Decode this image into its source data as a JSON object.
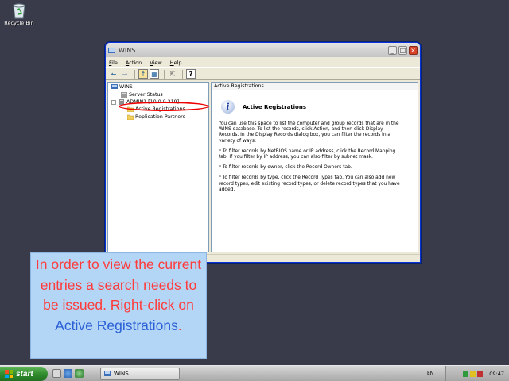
{
  "desktop": {
    "recycle_bin_label": "Recycle Bin"
  },
  "window": {
    "title": "WINS",
    "menu": [
      "File",
      "Action",
      "View",
      "Help"
    ],
    "tree": {
      "root": "WINS",
      "server_status": "Server Status",
      "server": "ADMIN1 [10.0.0.219]",
      "active_registrations": "Active Registrations",
      "replication_partners": "Replication Partners"
    },
    "pane": {
      "header": "Active Registrations",
      "info_title": "Active Registrations",
      "paragraphs": [
        "You can use this space to list the computer and group records that are in the WINS database. To list the records, click Action, and then click Display Records. In the Display Records dialog box, you can filter the records in a variety of ways:",
        "* To filter records by NetBIOS name or IP address, click the Record Mapping tab. If you filter by IP address, you can also filter by subnet mask.",
        "* To filter records by owner, click the Record Owners tab.",
        "* To filter records by type, click the Record Types tab. You can also add new record types, edit existing record types, or delete record types that you have added."
      ]
    }
  },
  "instruction": {
    "text": "In order to view the current entries a search needs to be issued. Right-click on",
    "highlight": "Active Registrations",
    "period": "."
  },
  "taskbar": {
    "start_label": "start",
    "task_label": "WINS",
    "lang": "EN",
    "clock": "09:47"
  },
  "colors": {
    "desktop": "#3a3b4a",
    "instruction_bg": "#b4d6f6",
    "instruction_text": "#ff3b3b",
    "highlight": "#2a5fd6",
    "annotation_oval": "#e00000"
  }
}
